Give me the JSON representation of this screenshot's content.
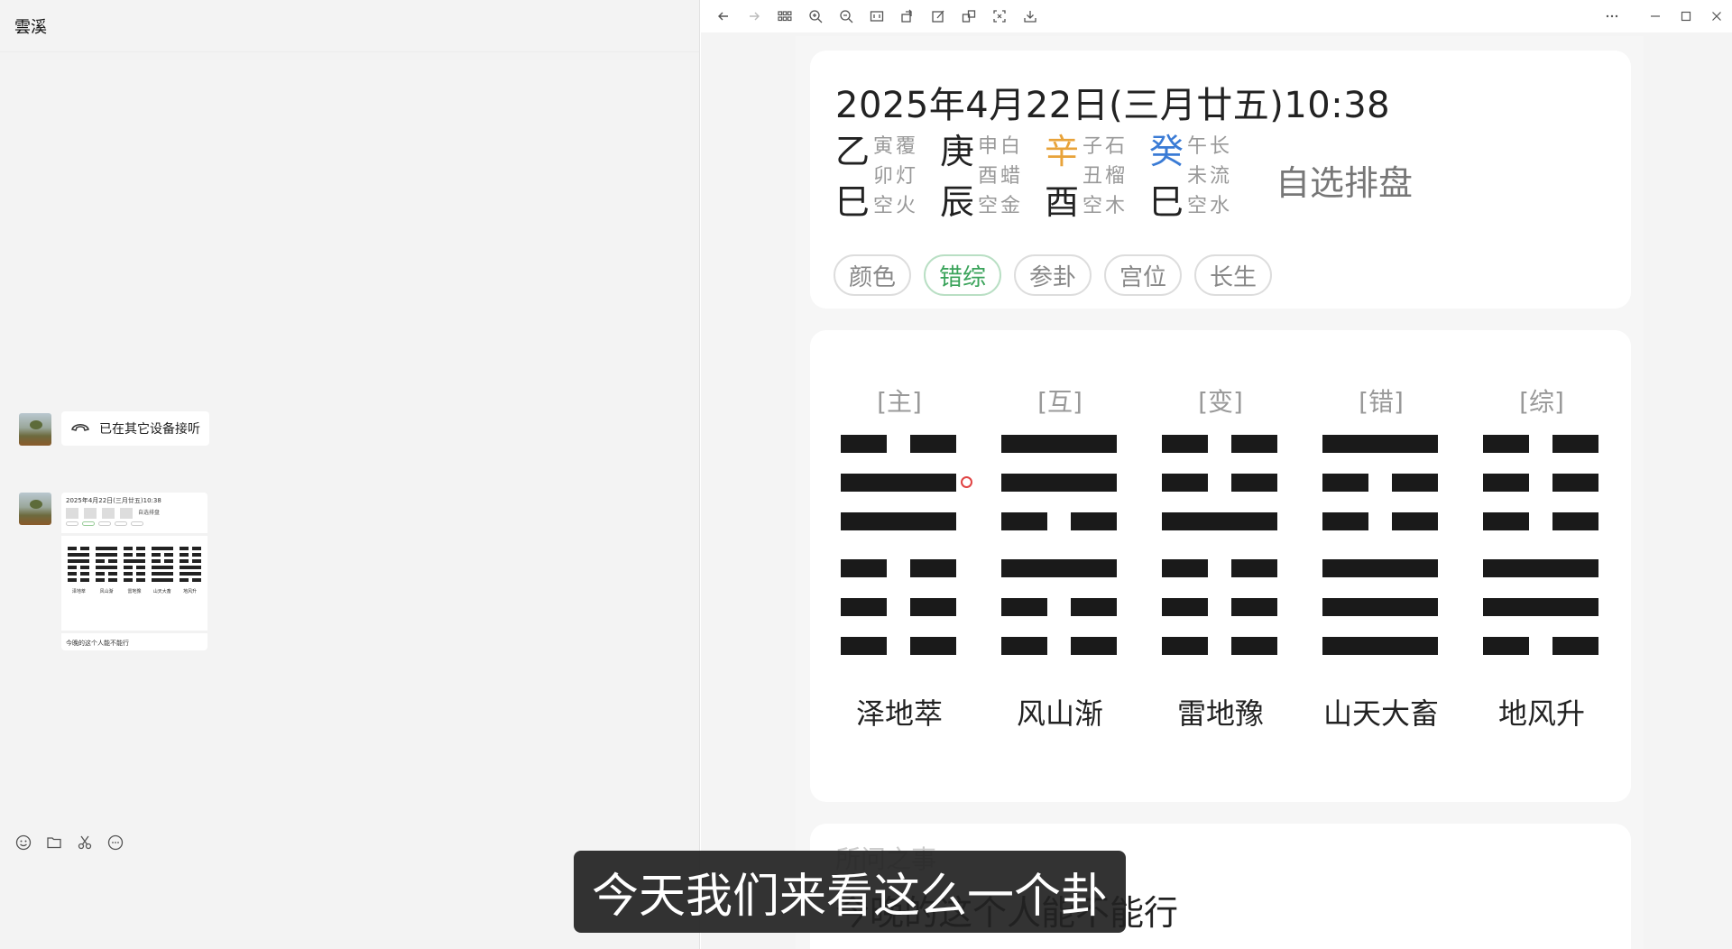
{
  "chat": {
    "contact_name": "雲溪",
    "call_status": "已在其它设备接听",
    "thumb": {
      "title": "2025年4月22日(三月廿五)10:38",
      "custom": "自选排盘",
      "hex_names": [
        "泽地萃",
        "风山渐",
        "雷地豫",
        "山天大畜",
        "地风升"
      ],
      "footer": "今晚的这个人能不能行"
    },
    "tools": [
      "emoji-icon",
      "folder-icon",
      "scissors-icon",
      "chat-bubble-icon"
    ]
  },
  "toolbar": {
    "buttons": [
      "back-icon",
      "forward-icon",
      "grid-icon",
      "zoom-in-icon",
      "zoom-out-icon",
      "fit-icon",
      "rotate-icon",
      "edit-icon",
      "translate-icon",
      "screenshot-icon",
      "download-icon"
    ],
    "window": [
      "more-icon",
      "minimize-icon",
      "maximize-icon",
      "close-icon"
    ]
  },
  "chart": {
    "datetime": "2025年4月22日(三月廿五)10:38",
    "pillars": [
      {
        "gan": "乙",
        "zhi": "巳",
        "gan_color": "#222222",
        "small": [
          "寅覆",
          "卯灯",
          "空火"
        ]
      },
      {
        "gan": "庚",
        "zhi": "辰",
        "gan_color": "#222222",
        "small": [
          "申白",
          "酉蜡",
          "空金"
        ]
      },
      {
        "gan": "辛",
        "zhi": "酉",
        "gan_color": "#e8a33a",
        "small": [
          "子石",
          "丑榴",
          "空木"
        ]
      },
      {
        "gan": "癸",
        "zhi": "巳",
        "gan_color": "#3a7bd5",
        "small": [
          "午长",
          "未流",
          "空水"
        ]
      }
    ],
    "custom_label": "自选排盘",
    "pills": [
      {
        "label": "颜色",
        "active": false
      },
      {
        "label": "错综",
        "active": true
      },
      {
        "label": "参卦",
        "active": false
      },
      {
        "label": "宫位",
        "active": false
      },
      {
        "label": "长生",
        "active": false
      }
    ],
    "accent_green": "#3aa35a",
    "moving_line_color": "#e04343"
  },
  "hexagrams": [
    {
      "label": "[主]",
      "name": "泽地萃",
      "lines": [
        "yin",
        "yang",
        "yang",
        "yin",
        "yin",
        "yin"
      ],
      "moving": 1
    },
    {
      "label": "[互]",
      "name": "风山渐",
      "lines": [
        "yang",
        "yang",
        "yin",
        "yang",
        "yin",
        "yin"
      ],
      "moving": null
    },
    {
      "label": "[变]",
      "name": "雷地豫",
      "lines": [
        "yin",
        "yin",
        "yang",
        "yin",
        "yin",
        "yin"
      ],
      "moving": null
    },
    {
      "label": "[错]",
      "name": "山天大畜",
      "lines": [
        "yang",
        "yin",
        "yin",
        "yang",
        "yang",
        "yang"
      ],
      "moving": null
    },
    {
      "label": "[综]",
      "name": "地风升",
      "lines": [
        "yin",
        "yin",
        "yin",
        "yang",
        "yang",
        "yin"
      ],
      "moving": null
    }
  ],
  "question": {
    "label": "所问之事",
    "text": "今晚的这个人能不能行"
  },
  "subtitle": "今天我们来看这么一个卦"
}
